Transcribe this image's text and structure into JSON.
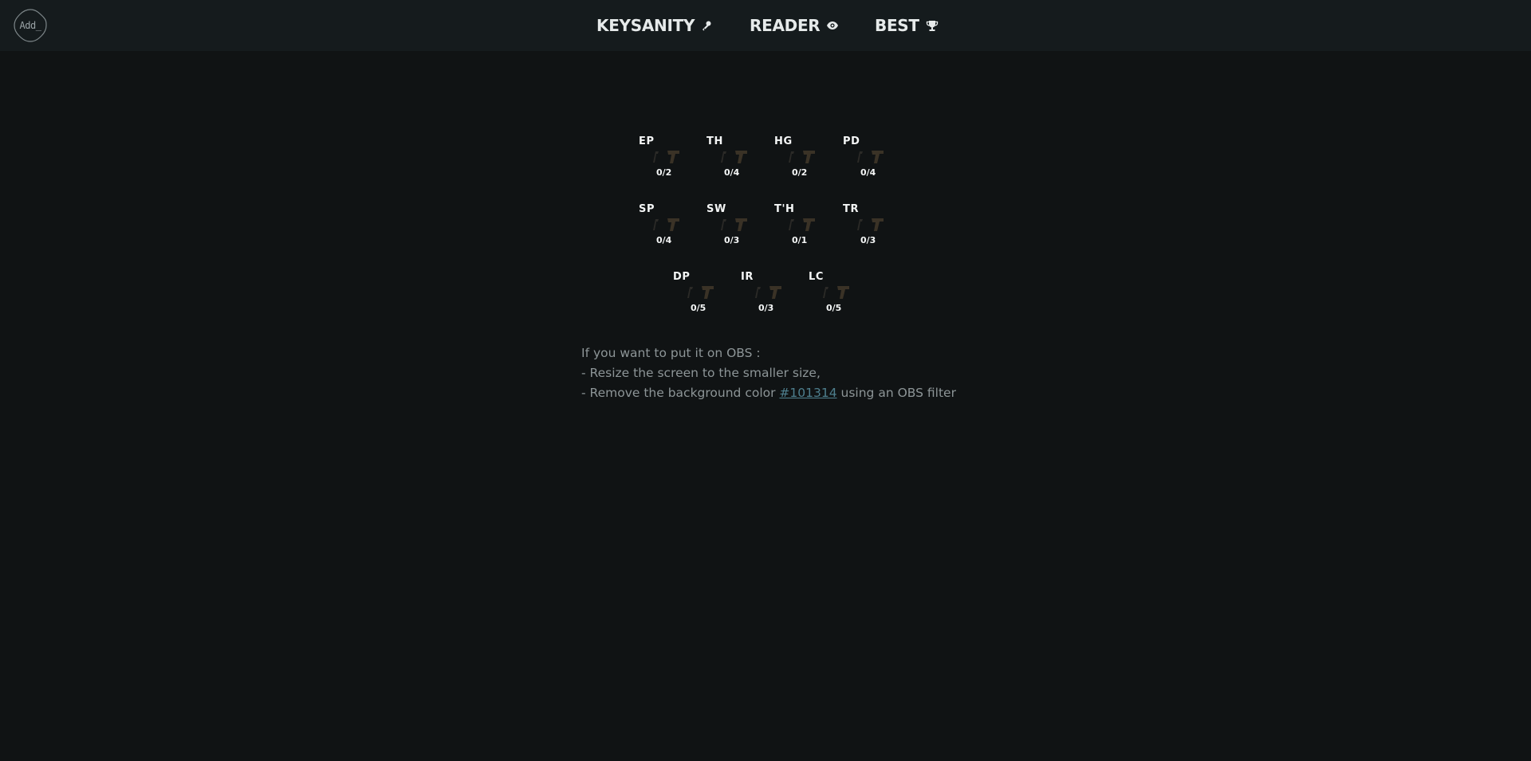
{
  "header": {
    "logo_text": "Add_",
    "nav": [
      {
        "label": "KEYSANITY",
        "icon": "key-icon"
      },
      {
        "label": "READER",
        "icon": "eye-icon"
      },
      {
        "label": "BEST",
        "icon": "trophy-icon"
      }
    ]
  },
  "dungeons": [
    {
      "name": "EP",
      "count": "0/2"
    },
    {
      "name": "TH",
      "count": "0/4"
    },
    {
      "name": "HG",
      "count": "0/2"
    },
    {
      "name": "PD",
      "count": "0/4"
    },
    {
      "name": "SP",
      "count": "0/4"
    },
    {
      "name": "SW",
      "count": "0/3"
    },
    {
      "name": "T'H",
      "count": "0/1"
    },
    {
      "name": "TR",
      "count": "0/3"
    },
    {
      "name": "DP",
      "count": "0/5"
    },
    {
      "name": "IR",
      "count": "0/3"
    },
    {
      "name": "LC",
      "count": "0/5"
    }
  ],
  "dungeon_icons": [
    "small-key-icon",
    "big-key-icon"
  ],
  "obs": {
    "line1": "If you want to put it on OBS :",
    "line2": "- Resize the screen to the smaller size,",
    "line3_prefix": "- Remove the background color ",
    "color_link": "#101314",
    "line3_suffix": " using an OBS filter"
  },
  "colors": {
    "background": "#101314",
    "header_bg": "#151b1d",
    "link": "#4e7f8e",
    "key_dim": "#3a3226"
  }
}
